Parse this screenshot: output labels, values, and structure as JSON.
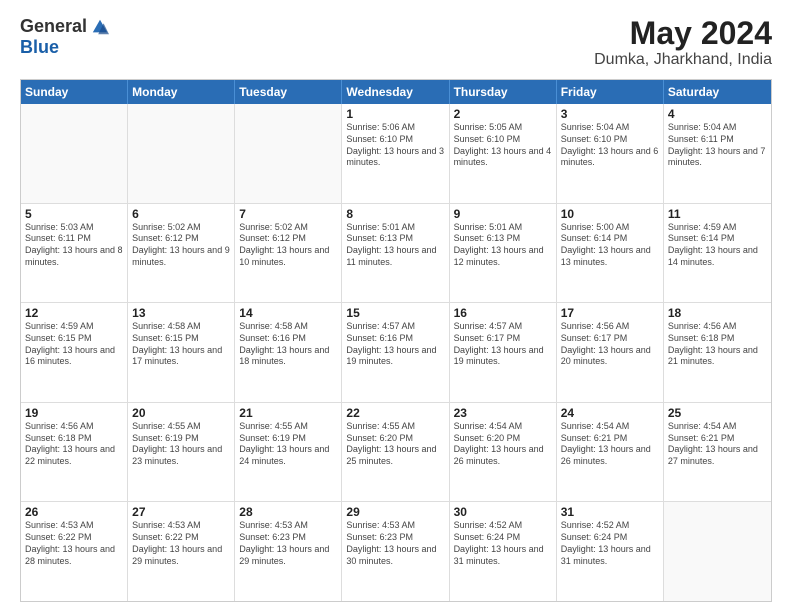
{
  "logo": {
    "general": "General",
    "blue": "Blue"
  },
  "title": "May 2024",
  "location": "Dumka, Jharkhand, India",
  "days_of_week": [
    "Sunday",
    "Monday",
    "Tuesday",
    "Wednesday",
    "Thursday",
    "Friday",
    "Saturday"
  ],
  "weeks": [
    [
      {
        "day": "",
        "info": ""
      },
      {
        "day": "",
        "info": ""
      },
      {
        "day": "",
        "info": ""
      },
      {
        "day": "1",
        "info": "Sunrise: 5:06 AM\nSunset: 6:10 PM\nDaylight: 13 hours and 3 minutes."
      },
      {
        "day": "2",
        "info": "Sunrise: 5:05 AM\nSunset: 6:10 PM\nDaylight: 13 hours and 4 minutes."
      },
      {
        "day": "3",
        "info": "Sunrise: 5:04 AM\nSunset: 6:10 PM\nDaylight: 13 hours and 6 minutes."
      },
      {
        "day": "4",
        "info": "Sunrise: 5:04 AM\nSunset: 6:11 PM\nDaylight: 13 hours and 7 minutes."
      }
    ],
    [
      {
        "day": "5",
        "info": "Sunrise: 5:03 AM\nSunset: 6:11 PM\nDaylight: 13 hours and 8 minutes."
      },
      {
        "day": "6",
        "info": "Sunrise: 5:02 AM\nSunset: 6:12 PM\nDaylight: 13 hours and 9 minutes."
      },
      {
        "day": "7",
        "info": "Sunrise: 5:02 AM\nSunset: 6:12 PM\nDaylight: 13 hours and 10 minutes."
      },
      {
        "day": "8",
        "info": "Sunrise: 5:01 AM\nSunset: 6:13 PM\nDaylight: 13 hours and 11 minutes."
      },
      {
        "day": "9",
        "info": "Sunrise: 5:01 AM\nSunset: 6:13 PM\nDaylight: 13 hours and 12 minutes."
      },
      {
        "day": "10",
        "info": "Sunrise: 5:00 AM\nSunset: 6:14 PM\nDaylight: 13 hours and 13 minutes."
      },
      {
        "day": "11",
        "info": "Sunrise: 4:59 AM\nSunset: 6:14 PM\nDaylight: 13 hours and 14 minutes."
      }
    ],
    [
      {
        "day": "12",
        "info": "Sunrise: 4:59 AM\nSunset: 6:15 PM\nDaylight: 13 hours and 16 minutes."
      },
      {
        "day": "13",
        "info": "Sunrise: 4:58 AM\nSunset: 6:15 PM\nDaylight: 13 hours and 17 minutes."
      },
      {
        "day": "14",
        "info": "Sunrise: 4:58 AM\nSunset: 6:16 PM\nDaylight: 13 hours and 18 minutes."
      },
      {
        "day": "15",
        "info": "Sunrise: 4:57 AM\nSunset: 6:16 PM\nDaylight: 13 hours and 19 minutes."
      },
      {
        "day": "16",
        "info": "Sunrise: 4:57 AM\nSunset: 6:17 PM\nDaylight: 13 hours and 19 minutes."
      },
      {
        "day": "17",
        "info": "Sunrise: 4:56 AM\nSunset: 6:17 PM\nDaylight: 13 hours and 20 minutes."
      },
      {
        "day": "18",
        "info": "Sunrise: 4:56 AM\nSunset: 6:18 PM\nDaylight: 13 hours and 21 minutes."
      }
    ],
    [
      {
        "day": "19",
        "info": "Sunrise: 4:56 AM\nSunset: 6:18 PM\nDaylight: 13 hours and 22 minutes."
      },
      {
        "day": "20",
        "info": "Sunrise: 4:55 AM\nSunset: 6:19 PM\nDaylight: 13 hours and 23 minutes."
      },
      {
        "day": "21",
        "info": "Sunrise: 4:55 AM\nSunset: 6:19 PM\nDaylight: 13 hours and 24 minutes."
      },
      {
        "day": "22",
        "info": "Sunrise: 4:55 AM\nSunset: 6:20 PM\nDaylight: 13 hours and 25 minutes."
      },
      {
        "day": "23",
        "info": "Sunrise: 4:54 AM\nSunset: 6:20 PM\nDaylight: 13 hours and 26 minutes."
      },
      {
        "day": "24",
        "info": "Sunrise: 4:54 AM\nSunset: 6:21 PM\nDaylight: 13 hours and 26 minutes."
      },
      {
        "day": "25",
        "info": "Sunrise: 4:54 AM\nSunset: 6:21 PM\nDaylight: 13 hours and 27 minutes."
      }
    ],
    [
      {
        "day": "26",
        "info": "Sunrise: 4:53 AM\nSunset: 6:22 PM\nDaylight: 13 hours and 28 minutes."
      },
      {
        "day": "27",
        "info": "Sunrise: 4:53 AM\nSunset: 6:22 PM\nDaylight: 13 hours and 29 minutes."
      },
      {
        "day": "28",
        "info": "Sunrise: 4:53 AM\nSunset: 6:23 PM\nDaylight: 13 hours and 29 minutes."
      },
      {
        "day": "29",
        "info": "Sunrise: 4:53 AM\nSunset: 6:23 PM\nDaylight: 13 hours and 30 minutes."
      },
      {
        "day": "30",
        "info": "Sunrise: 4:52 AM\nSunset: 6:24 PM\nDaylight: 13 hours and 31 minutes."
      },
      {
        "day": "31",
        "info": "Sunrise: 4:52 AM\nSunset: 6:24 PM\nDaylight: 13 hours and 31 minutes."
      },
      {
        "day": "",
        "info": ""
      }
    ]
  ]
}
